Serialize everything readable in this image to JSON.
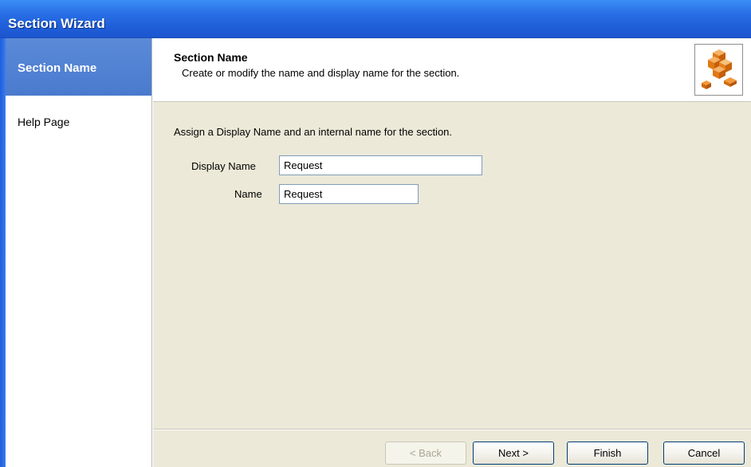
{
  "window": {
    "title": "Section Wizard"
  },
  "sidebar": {
    "items": [
      {
        "label": "Section Name",
        "active": true
      },
      {
        "label": "Help Page",
        "active": false
      }
    ]
  },
  "header": {
    "title": "Section Name",
    "subtitle": "Create or modify the name and display name for the section.",
    "icon": "stacked-blocks-icon"
  },
  "form": {
    "instruction": "Assign a Display Name and an internal name for the section.",
    "display_name_label": "Display Name",
    "display_name_value": "Request",
    "name_label": "Name",
    "name_value": "Request"
  },
  "buttons": {
    "back": "< Back",
    "next": "Next >",
    "finish": "Finish",
    "cancel": "Cancel"
  },
  "colors": {
    "titlebar": "#2a6fe6",
    "sidebar_active": "#4f7fd2",
    "content_bg": "#ece9d8",
    "icon_orange": "#e8801c"
  }
}
